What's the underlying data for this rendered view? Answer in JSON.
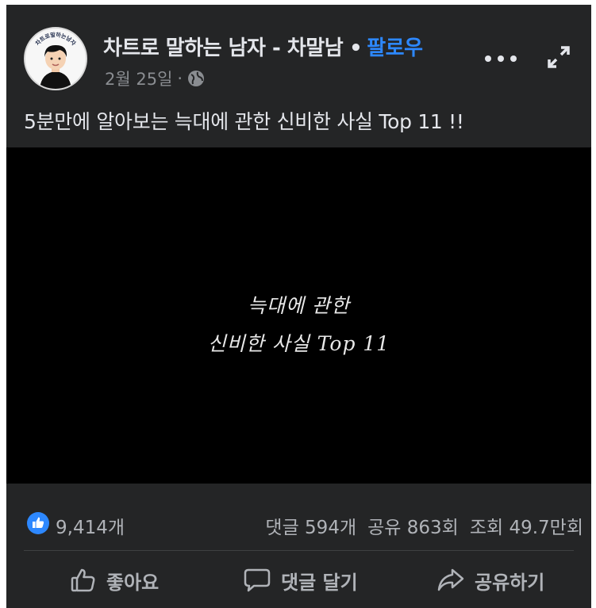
{
  "post": {
    "page_name": "차트로 말하는 남자 - 차말남",
    "dot": "•",
    "follow_label": "팔로우",
    "date": "2월 25일",
    "meta_sep": "·",
    "caption": "5분만에 알아보는 늑대에 관한 신비한 사실 Top 11 !!",
    "avatar_badge_text": "차트로말하는남자"
  },
  "video": {
    "title_line1": "늑대에 관한",
    "title_line2": "신비한 사실 Top 11"
  },
  "stats": {
    "likes": "9,414개",
    "comments": "댓글 594개",
    "shares": "공유 863회",
    "views": "조회 49.7만회"
  },
  "actions": {
    "like_label": "좋아요",
    "comment_label": "댓글 달기",
    "share_label": "공유하기"
  },
  "icons": {
    "more": "more-icon",
    "expand": "expand-icon",
    "globe": "globe-icon",
    "like": "thumbs-up-icon",
    "comment": "comment-bubble-icon",
    "share": "share-arrow-icon"
  },
  "colors": {
    "card_bg": "#242526",
    "primary_text": "#e4e6eb",
    "secondary_text": "#b0b3b8",
    "accent": "#2d88ff",
    "video_bg": "#000000"
  }
}
